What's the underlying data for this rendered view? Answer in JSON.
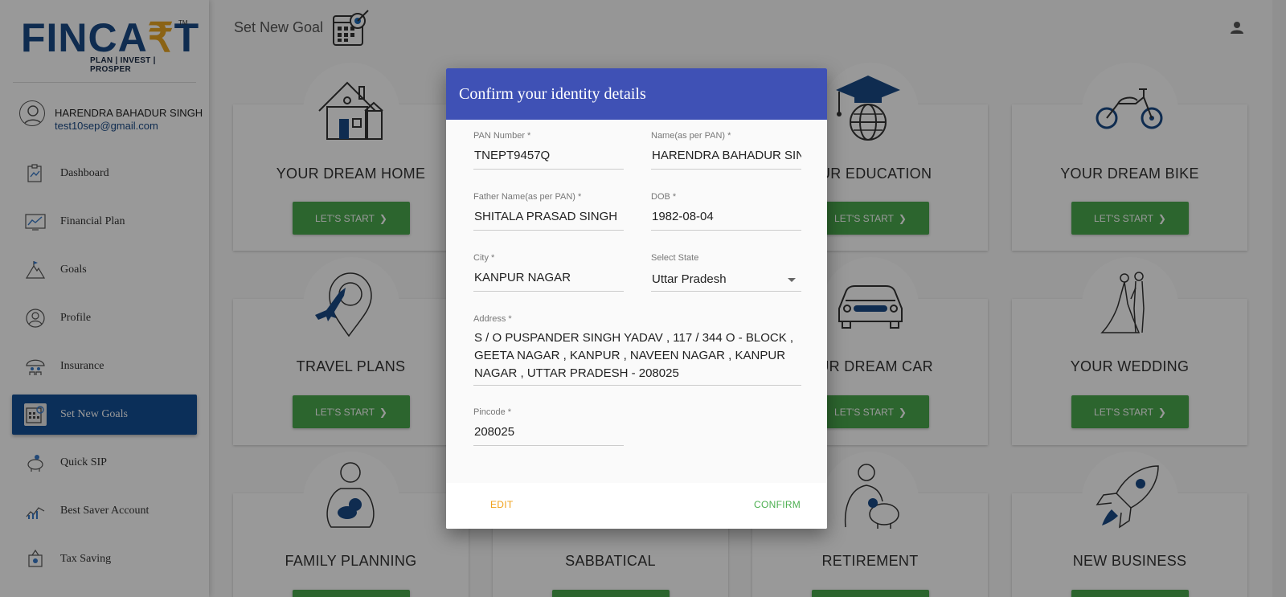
{
  "brand": {
    "logo_text_a": "FINCA",
    "logo_text_rupee": "₹",
    "logo_text_b": "T",
    "trademark": "TM",
    "tagline": "PLAN | INVEST | PROSPER"
  },
  "user": {
    "name": "HARENDRA BAHADUR SINGH",
    "email": "test10sep@gmail.com"
  },
  "sidebar": {
    "items": [
      {
        "label": "Dashboard",
        "icon": "dashboard-icon"
      },
      {
        "label": "Financial Plan",
        "icon": "chart-icon"
      },
      {
        "label": "Goals",
        "icon": "mountain-flag-icon"
      },
      {
        "label": "Profile",
        "icon": "profile-icon"
      },
      {
        "label": "Insurance",
        "icon": "umbrella-family-icon"
      },
      {
        "label": "Set New Goals",
        "icon": "calendar-target-icon",
        "active": true
      },
      {
        "label": "Quick SIP",
        "icon": "piggy-bank-icon"
      },
      {
        "label": "Best Saver Account",
        "icon": "savings-growth-icon"
      },
      {
        "label": "Tax Saving",
        "icon": "tax-icon"
      }
    ]
  },
  "header": {
    "title": "Set New Goal",
    "icon": "calendar-target-icon",
    "user_icon": "user-icon"
  },
  "goal_button_label": "LET'S START",
  "goals": [
    {
      "title": "YOUR DREAM HOME",
      "icon": "house-icon"
    },
    {
      "title": "",
      "icon": ""
    },
    {
      "title": "OUR EDUCATION",
      "icon": "graduation-globe-icon"
    },
    {
      "title": "YOUR DREAM BIKE",
      "icon": "motorbike-icon"
    },
    {
      "title": "TRAVEL PLANS",
      "icon": "airplane-pin-icon"
    },
    {
      "title": "",
      "icon": ""
    },
    {
      "title": "OUR DREAM CAR",
      "icon": "car-icon"
    },
    {
      "title": "YOUR WEDDING",
      "icon": "wedding-couple-icon"
    },
    {
      "title": "FAMILY PLANNING",
      "icon": "family-baby-icon"
    },
    {
      "title": "SABBATICAL",
      "icon": ""
    },
    {
      "title": "RETIREMENT",
      "icon": "retiree-piggy-icon"
    },
    {
      "title": "NEW BUSINESS",
      "icon": "rocket-icon"
    }
  ],
  "dialog": {
    "title": "Confirm your identity details",
    "pan": {
      "label": "PAN Number *",
      "value": "TNEPT9457Q"
    },
    "name": {
      "label": "Name(as per PAN) *",
      "value": "HARENDRA BAHADUR SINGH"
    },
    "father": {
      "label": "Father Name(as per PAN) *",
      "value": "SHITALA PRASAD SINGH"
    },
    "dob": {
      "label": "DOB *",
      "value": "1982-08-04"
    },
    "city": {
      "label": "City *",
      "value": "KANPUR NAGAR"
    },
    "state": {
      "label": "Select State",
      "value": "Uttar Pradesh"
    },
    "address": {
      "label": "Address *",
      "value": "S / O PUSPANDER SINGH YADAV , 117 / 344 O - BLOCK , GEETA NAGAR , KANPUR , NAVEEN NAGAR , KANPUR NAGAR , UTTAR PRADESH - 208025"
    },
    "pincode": {
      "label": "Pincode *",
      "value": "208025"
    },
    "edit_label": "EDIT",
    "confirm_label": "CONFIRM"
  },
  "colors": {
    "brand_blue": "#1a4a86",
    "accent_gold": "#e8a522",
    "active_nav": "#134f95",
    "dialog_header": "#3f51b5",
    "start_green": "#4aa84e",
    "edit_orange": "#f0a11b",
    "confirm_green": "#4caf50"
  }
}
